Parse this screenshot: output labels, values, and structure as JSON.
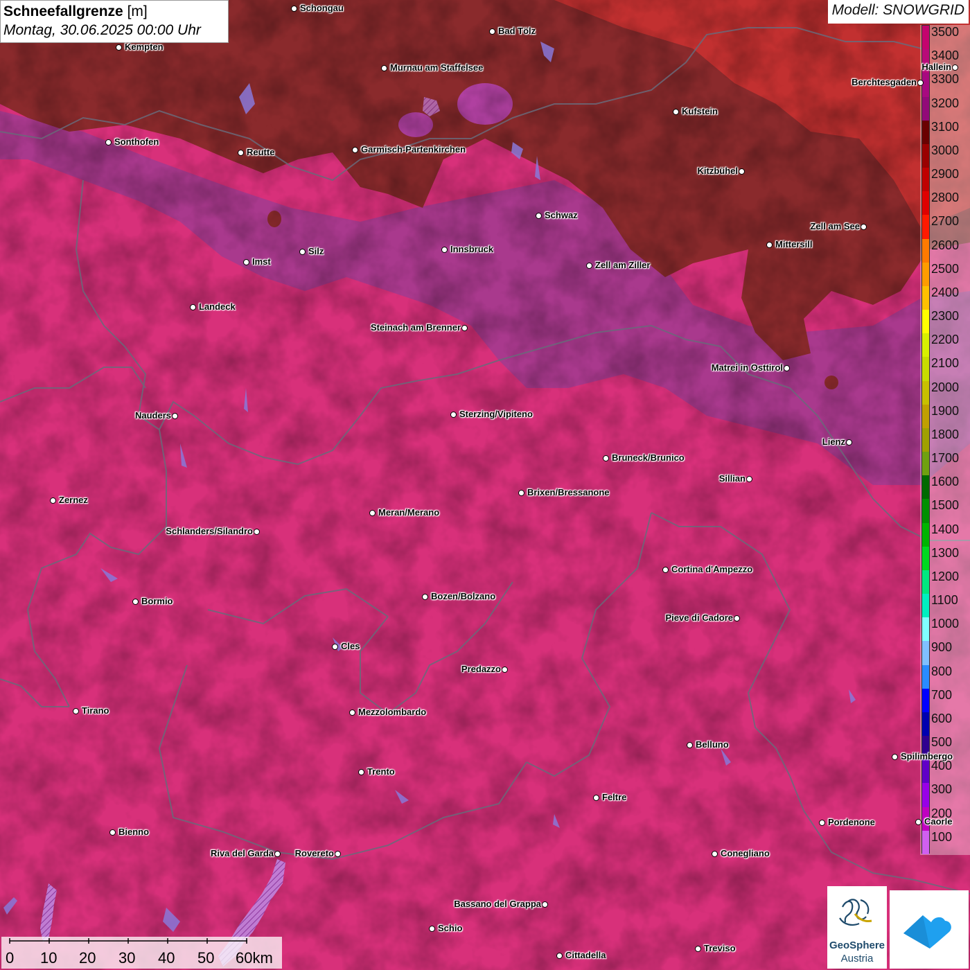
{
  "header": {
    "title_bold": "Schneefallgrenze",
    "title_unit": " [m]",
    "subtitle": "Montag, 30.06.2025 00:00 Uhr",
    "model": "Modell: SNOWGRID"
  },
  "legend": {
    "levels": [
      {
        "value": "3500",
        "color": "#c4046e"
      },
      {
        "value": "3400",
        "color": "#b80a78"
      },
      {
        "value": "3300",
        "color": "#a80a80"
      },
      {
        "value": "3200",
        "color": "#920a78"
      },
      {
        "value": "3100",
        "color": "#6a0000"
      },
      {
        "value": "3000",
        "color": "#9a0000"
      },
      {
        "value": "2900",
        "color": "#c00000"
      },
      {
        "value": "2800",
        "color": "#e00000"
      },
      {
        "value": "2700",
        "color": "#ff1a00"
      },
      {
        "value": "2600",
        "color": "#ff7a00"
      },
      {
        "value": "2500",
        "color": "#ff9c00"
      },
      {
        "value": "2400",
        "color": "#ffc000"
      },
      {
        "value": "2300",
        "color": "#ffff00"
      },
      {
        "value": "2200",
        "color": "#d8f000"
      },
      {
        "value": "2100",
        "color": "#c8dc00"
      },
      {
        "value": "2000",
        "color": "#c8c000"
      },
      {
        "value": "1900",
        "color": "#c0a000"
      },
      {
        "value": "1800",
        "color": "#a0a000"
      },
      {
        "value": "1700",
        "color": "#70a010"
      },
      {
        "value": "1600",
        "color": "#006a00"
      },
      {
        "value": "1500",
        "color": "#009000"
      },
      {
        "value": "1400",
        "color": "#00b400"
      },
      {
        "value": "1300",
        "color": "#00d820"
      },
      {
        "value": "1200",
        "color": "#00e880"
      },
      {
        "value": "1100",
        "color": "#00f0c0"
      },
      {
        "value": "1000",
        "color": "#80ffff"
      },
      {
        "value": "900",
        "color": "#80c0ff"
      },
      {
        "value": "800",
        "color": "#2a8cff"
      },
      {
        "value": "700",
        "color": "#0000ff"
      },
      {
        "value": "600",
        "color": "#0000b0"
      },
      {
        "value": "500",
        "color": "#300090"
      },
      {
        "value": "400",
        "color": "#6000c8"
      },
      {
        "value": "300",
        "color": "#9800e8"
      },
      {
        "value": "200",
        "color": "#c000c0"
      },
      {
        "value": "100",
        "color": "#d060f0"
      }
    ]
  },
  "cities": [
    {
      "name": "Schongau",
      "side": "right"
    },
    {
      "name": "Bad Tölz",
      "side": "right"
    },
    {
      "name": "Kempten",
      "side": "right"
    },
    {
      "name": "Murnau am Staffelsee",
      "side": "right"
    },
    {
      "name": "Kufstein",
      "side": "right"
    },
    {
      "name": "Berchtesgaden",
      "side": "left"
    },
    {
      "name": "Sonthofen",
      "side": "right"
    },
    {
      "name": "Reutte",
      "side": "right"
    },
    {
      "name": "Garmisch-Partenkirchen",
      "side": "right"
    },
    {
      "name": "Kitzbühel",
      "side": "left"
    },
    {
      "name": "Schwaz",
      "side": "right"
    },
    {
      "name": "Zell am See",
      "side": "left"
    },
    {
      "name": "Innsbruck",
      "side": "right"
    },
    {
      "name": "Mittersill",
      "side": "right"
    },
    {
      "name": "Imst",
      "side": "right"
    },
    {
      "name": "Silz",
      "side": "right"
    },
    {
      "name": "Zell am Ziller",
      "side": "right"
    },
    {
      "name": "Landeck",
      "side": "right"
    },
    {
      "name": "Steinach am Brenner",
      "side": "left"
    },
    {
      "name": "Matrei in Osttirol",
      "side": "left"
    },
    {
      "name": "Nauders",
      "side": "left"
    },
    {
      "name": "Sterzing/Vipiteno",
      "side": "right"
    },
    {
      "name": "Lienz",
      "side": "left"
    },
    {
      "name": "Bruneck/Brunico",
      "side": "right"
    },
    {
      "name": "Sillian",
      "side": "left"
    },
    {
      "name": "Brixen/Bressanone",
      "side": "right"
    },
    {
      "name": "Zernez",
      "side": "right"
    },
    {
      "name": "Meran/Merano",
      "side": "right"
    },
    {
      "name": "Schlanders/Silandro",
      "side": "left"
    },
    {
      "name": "Cortina d'Ampezzo",
      "side": "right"
    },
    {
      "name": "Bozen/Bolzano",
      "side": "right"
    },
    {
      "name": "Bormio",
      "side": "right"
    },
    {
      "name": "Pieve di Cadore",
      "side": "left"
    },
    {
      "name": "Cles",
      "side": "right"
    },
    {
      "name": "Predazzo",
      "side": "left"
    },
    {
      "name": "Tirano",
      "side": "right"
    },
    {
      "name": "Mezzolombardo",
      "side": "right"
    },
    {
      "name": "Belluno",
      "side": "right"
    },
    {
      "name": "Spilimbergo",
      "side": "right"
    },
    {
      "name": "Trento",
      "side": "right"
    },
    {
      "name": "Feltre",
      "side": "right"
    },
    {
      "name": "Pordenone",
      "side": "right"
    },
    {
      "name": "Bienno",
      "side": "right"
    },
    {
      "name": "Riva del Garda",
      "side": "left"
    },
    {
      "name": "Rovereto",
      "side": "left"
    },
    {
      "name": "Conegliano",
      "side": "right"
    },
    {
      "name": "Bassano del Grappa",
      "side": "left"
    },
    {
      "name": "Schio",
      "side": "right"
    },
    {
      "name": "Treviso",
      "side": "right"
    },
    {
      "name": "Cittadella",
      "side": "right"
    },
    {
      "name": "Hallein",
      "side": "left"
    },
    {
      "name": "Caorle",
      "side": "right"
    }
  ],
  "scalebar": {
    "labels": [
      "0",
      "10",
      "20",
      "30",
      "40",
      "50",
      "60km"
    ]
  },
  "logos": {
    "geosphere_line1": "GeoSphere",
    "geosphere_line2": "Austria"
  }
}
